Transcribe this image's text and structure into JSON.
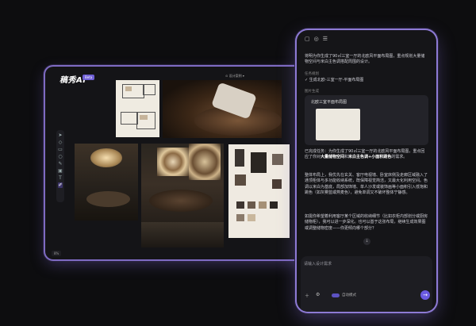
{
  "tablet": {
    "logo": "稿秀AI",
    "badge": "Beta",
    "top_control": "⊙ 设计案例 ▾",
    "zoom": "8%",
    "tools": [
      "pointer-icon",
      "select-icon",
      "frame-icon",
      "shape-icon",
      "pen-icon",
      "image-icon",
      "text-icon",
      "brush-icon"
    ]
  },
  "phone": {
    "top_icons": [
      "chat-icon",
      "history-icon",
      "settings-icon"
    ],
    "intro": "将明为你生成了90㎡三室一厅的北欧风平面布局图，重点规划大量储物空间与米白主色调搭配周围的设计。",
    "task_header": "任务规划",
    "task_item": "✓ 生成北欧-三室一厅-平面布局图",
    "result_header": "图片生成",
    "card_title": "北欧三室平面布局图",
    "summary_a": "已完成任务：为你生成了90㎡三室一厅的北欧风平面布局图，重点回应了你对",
    "summary_hl1": "大量储物空间",
    "summary_b": "和",
    "summary_hl2": "米白主色调+小面积跳色",
    "summary_c": "的需求。",
    "body": "整体布局上，我优先在玄关、客厅电视墙、卧室床侧及走廊区域融入了通顶柜体与多功能收纳系统，既保障视觉简洁，又最大化利用空间。色调以米白为基底，局部加饰墙、单人沙发或装饰画等小面积引入低饱和跳色（如灰雾蓝或燕麦色），避免单调又不破坏整体宁静感。",
    "followup": "如需你希望着利用客厅某个区域的收纳细节（比如衣柜内部划分或厨房储物柜），我可以进一步深化。也可以基于这张布局，继续生成效果图或调整储物密度——你更倾向哪个部分？",
    "input_placeholder": "请输入设计需求",
    "mode_label": "自动模式",
    "send_icon": "send-icon"
  }
}
